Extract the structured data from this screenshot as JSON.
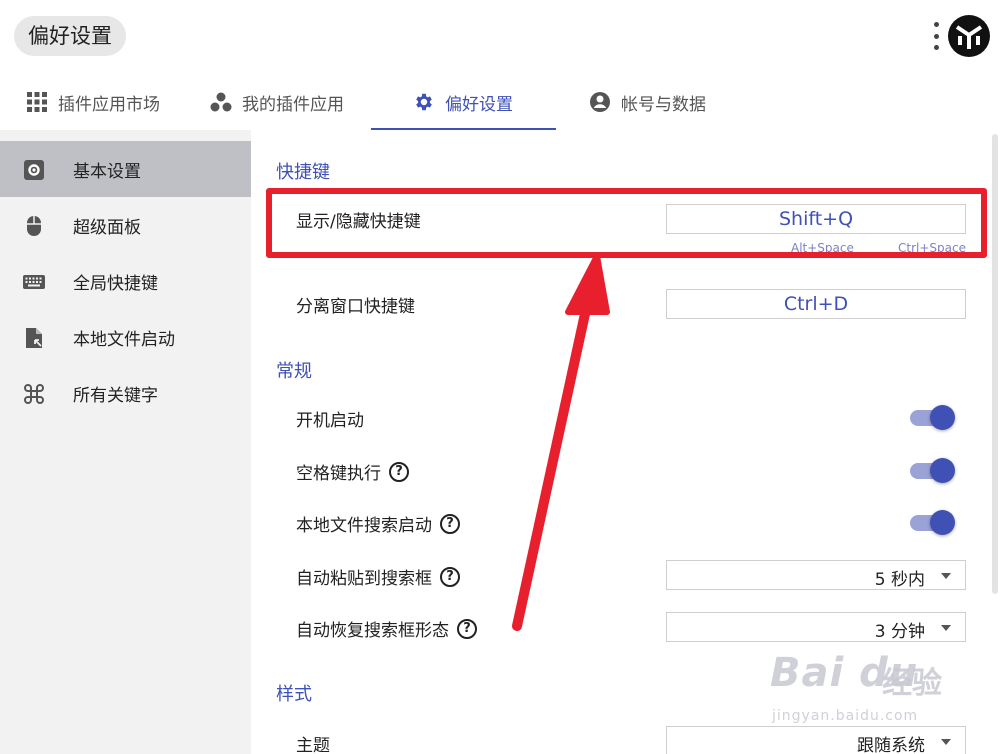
{
  "header": {
    "title": "偏好设置"
  },
  "tabs": [
    {
      "label": "插件应用市场",
      "icon": "grid-icon"
    },
    {
      "label": "我的插件应用",
      "icon": "bubbles-icon"
    },
    {
      "label": "偏好设置",
      "icon": "gear-icon",
      "active": true
    },
    {
      "label": "帐号与数据",
      "icon": "account-circle-icon"
    }
  ],
  "sidebar": {
    "items": [
      {
        "label": "基本设置",
        "icon": "settings-square-icon",
        "active": true
      },
      {
        "label": "超级面板",
        "icon": "mouse-icon"
      },
      {
        "label": "全局快捷键",
        "icon": "keyboard-icon"
      },
      {
        "label": "本地文件启动",
        "icon": "file-launch-icon"
      },
      {
        "label": "所有关键字",
        "icon": "command-key-icon"
      }
    ]
  },
  "sections": {
    "shortcuts": {
      "title": "快捷键",
      "rows": [
        {
          "label": "显示/隐藏快捷键",
          "value": "Shift+Q",
          "hints": [
            "Alt+Space",
            "Ctrl+Space"
          ]
        },
        {
          "label": "分离窗口快捷键",
          "value": "Ctrl+D"
        }
      ]
    },
    "general": {
      "title": "常规",
      "rows": [
        {
          "label": "开机启动",
          "toggle": true
        },
        {
          "label": "空格键执行",
          "toggle": true,
          "help": "?"
        },
        {
          "label": "本地文件搜索启动",
          "toggle": true,
          "help": "?"
        },
        {
          "label": "自动粘贴到搜索框",
          "select": "5 秒内",
          "help": "?"
        },
        {
          "label": "自动恢复搜索框形态",
          "select": "3 分钟",
          "help": "?"
        }
      ]
    },
    "style": {
      "title": "样式",
      "rows": [
        {
          "label": "主题",
          "select": "跟随系统"
        }
      ]
    }
  },
  "watermark": {
    "brand": "Bai du",
    "cn": "经验",
    "url": "jingyan.baidu.com"
  },
  "colors": {
    "accent": "#3f51b5",
    "annotation": "#e8202e"
  }
}
